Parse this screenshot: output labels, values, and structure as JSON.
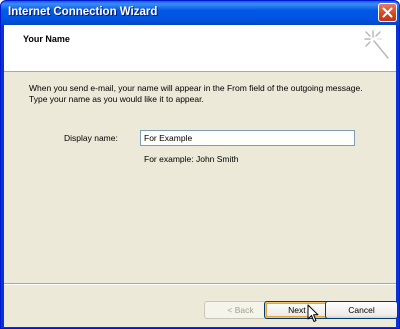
{
  "window": {
    "title": "Internet Connection Wizard",
    "close_icon": "close-icon"
  },
  "header": {
    "title": "Your Name",
    "icon": "wizard-wand-icon"
  },
  "content": {
    "intro_text": "When you send e-mail, your name will appear in the From field of the outgoing message. Type your name as you would like it to appear.",
    "display_name_label": "Display name:",
    "display_name_value": "For Example",
    "example_hint": "For example: John Smith"
  },
  "buttons": {
    "back_label": "< Back",
    "next_label": "Next >",
    "cancel_label": "Cancel"
  },
  "colors": {
    "title_bar": "#0054e3",
    "dialog_face": "#ece9d8",
    "close_button": "#d6431f"
  }
}
